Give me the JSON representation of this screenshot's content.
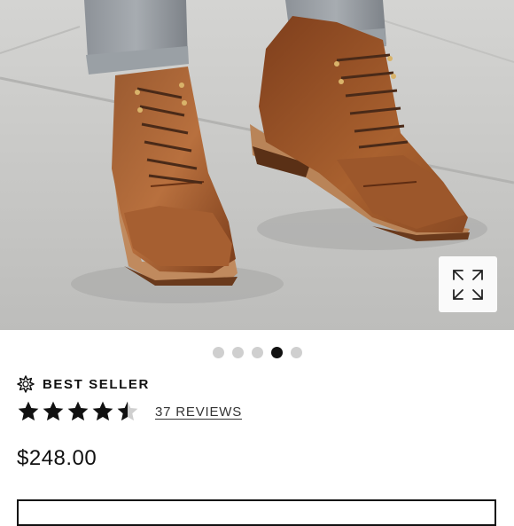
{
  "product_image": {
    "description_icon": "boots-photo",
    "expand_icon": "expand-arrows-icon",
    "carousel": {
      "total": 5,
      "active_index": 3
    }
  },
  "badge": {
    "icon": "starburst-outline-icon",
    "label": "BEST SELLER"
  },
  "rating": {
    "value": 4.5,
    "max": 5,
    "reviews_label": "37 REVIEWS"
  },
  "price": "$248.00",
  "colors": {
    "text": "#111111",
    "dot_inactive": "#cfcfcf",
    "dot_active": "#111111",
    "leather": "#8a4a24"
  }
}
